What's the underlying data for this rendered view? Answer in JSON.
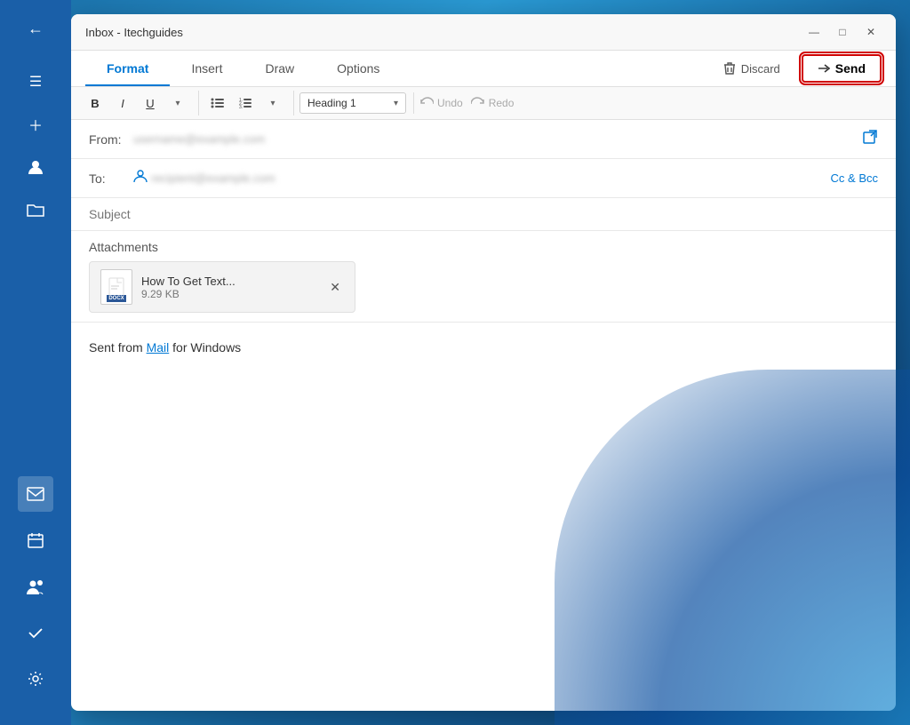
{
  "window": {
    "title": "Inbox - Itechguides",
    "controls": {
      "minimize": "—",
      "maximize": "□",
      "close": "✕"
    }
  },
  "tabs": {
    "items": [
      {
        "id": "format",
        "label": "Format",
        "active": true
      },
      {
        "id": "insert",
        "label": "Insert",
        "active": false
      },
      {
        "id": "draw",
        "label": "Draw",
        "active": false
      },
      {
        "id": "options",
        "label": "Options",
        "active": false
      }
    ],
    "discard_label": "Discard",
    "send_label": "Send"
  },
  "toolbar": {
    "bold": "B",
    "italic": "I",
    "underline": "U",
    "heading_dropdown": "Heading 1",
    "undo_label": "Undo",
    "redo_label": "Redo"
  },
  "compose": {
    "from_label": "From:",
    "from_value": "username@example.com",
    "to_label": "To:",
    "to_value": "recipient@example.com",
    "cc_bcc_label": "Cc & Bcc",
    "subject_placeholder": "Subject",
    "attachments_label": "Attachments",
    "attachment": {
      "name": "How To Get Text...",
      "size": "9.29 KB",
      "type": "DOCX"
    }
  },
  "body": {
    "text": "Sent from ",
    "link_text": "Mail",
    "text_after": " for Windows"
  },
  "sidebar": {
    "back_icon": "←",
    "menu_icon": "☰",
    "add_icon": "+",
    "user_icon": "👤",
    "folder_icon": "📁",
    "mail_icon": "✉",
    "calendar_icon": "📅",
    "people_icon": "👥",
    "todo_icon": "✓",
    "settings_icon": "⚙"
  }
}
